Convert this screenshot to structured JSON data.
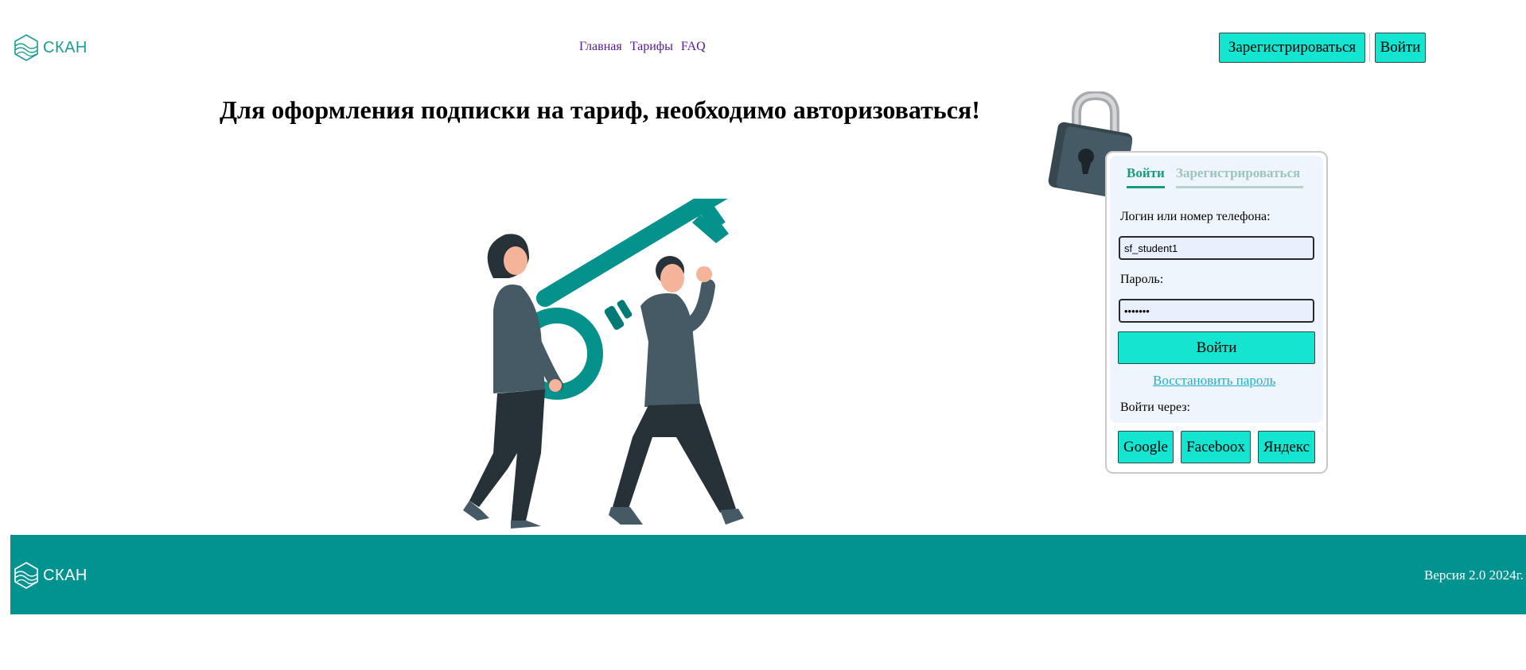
{
  "header": {
    "logo_text": "СКАН",
    "nav": [
      "Главная",
      "Тарифы",
      "FAQ"
    ],
    "register_label": "Зарегистрироваться",
    "login_label": "Войти"
  },
  "main": {
    "title": "Для оформления подписки на тариф, необходимо авторизоваться!"
  },
  "auth": {
    "tab_login": "Войти",
    "tab_register": "Зарегистрироваться",
    "login_label": "Логин или номер телефона:",
    "login_value": "sf_student1",
    "password_label": "Пароль:",
    "password_value": "•••••••",
    "submit_label": "Войти",
    "restore_label": "Восстановить пароль",
    "login_via_label": "Войти через:",
    "providers": [
      "Google",
      "Faceboox",
      "Яндекс"
    ]
  },
  "footer": {
    "logo_text": "СКАН",
    "version": "Версия 2.0 2024г."
  },
  "colors": {
    "accent": "#14e5d0",
    "teal": "#02928f",
    "brand": "#1b9c95",
    "tab_active": "#1a9c78"
  }
}
